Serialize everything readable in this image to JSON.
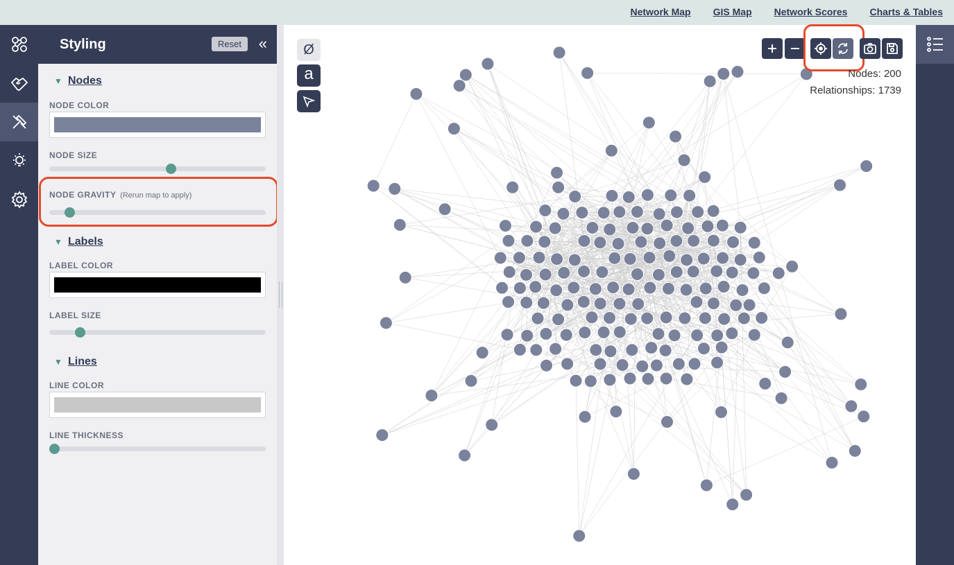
{
  "topnav": [
    "Network Map",
    "GIS Map",
    "Network Scores",
    "Charts & Tables"
  ],
  "panel": {
    "title": "Styling",
    "reset_label": "Reset",
    "collapse_glyph": "«"
  },
  "sections": {
    "nodes": "Nodes",
    "labels": "Labels",
    "lines": "Lines"
  },
  "fields": {
    "node_color": "NODE COLOR",
    "node_size": "NODE SIZE",
    "node_gravity": "NODE GRAVITY",
    "node_gravity_hint": "(Rerun map to apply)",
    "label_color": "LABEL COLOR",
    "label_size": "LABEL SIZE",
    "line_color": "LINE COLOR",
    "line_thickness": "LINE THICKNESS"
  },
  "values": {
    "node_color": "#7b829b",
    "label_color": "#000000",
    "line_color": "#c8c8c8",
    "node_size": 0.54,
    "node_gravity": 0.07,
    "label_size": 0.12,
    "line_thickness": 0.0
  },
  "tools": {
    "no_symbol": "Ø",
    "text_tool": "a"
  },
  "stats": {
    "nodes": "Nodes: 200",
    "relationships": "Relationships: 1739"
  },
  "colors": {
    "dark": "#353c56",
    "accent": "#5b9a8f",
    "highlight": "#e34b2b",
    "node": "#7b829b",
    "edge": "#cfcfcf"
  },
  "icons": {
    "rail": [
      "network-graph-icon",
      "handshake-icon",
      "paint-tools-icon",
      "lightbulb-icon",
      "gear-icon"
    ],
    "controls": [
      "plus-icon",
      "minus-icon",
      "recenter-target-icon",
      "refresh-layout-icon",
      "camera-icon",
      "save-icon"
    ],
    "right": "list-icon"
  }
}
